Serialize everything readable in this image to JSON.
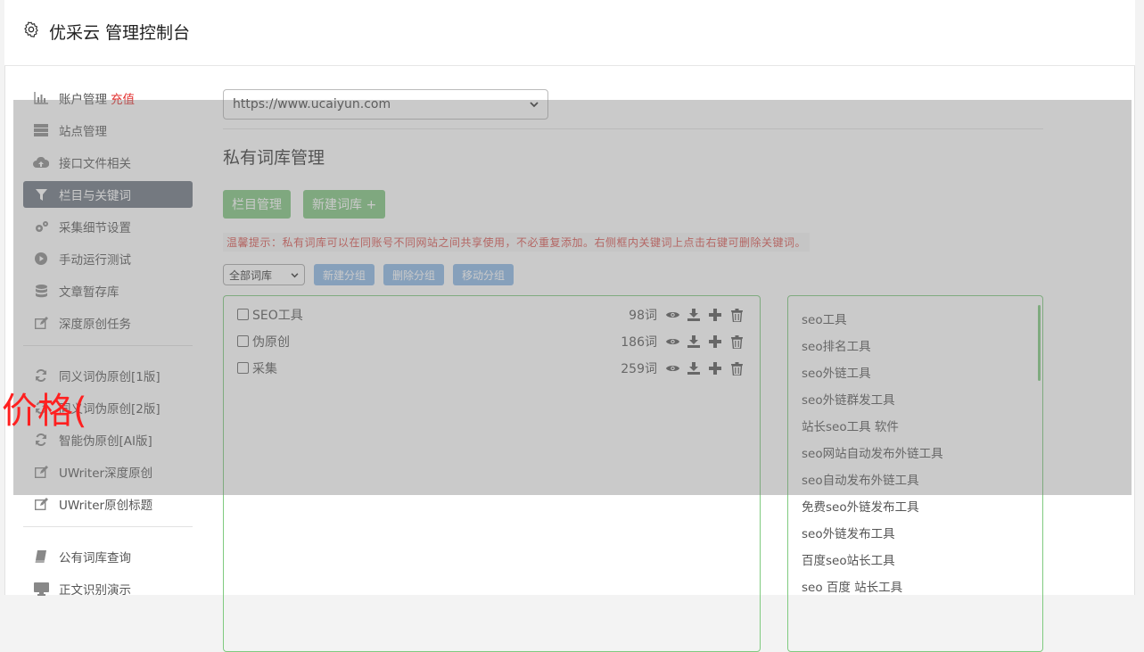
{
  "header": {
    "title": "优采云 管理控制台",
    "icon": "gear-icon"
  },
  "sidebar": {
    "groups": [
      [
        {
          "label": "账户管理",
          "extra": "充值",
          "icon": "bar-chart-icon"
        },
        {
          "label": "站点管理",
          "icon": "server-icon"
        },
        {
          "label": "接口文件相关",
          "icon": "cloud-upload-icon"
        },
        {
          "label": "栏目与关键词",
          "icon": "filter-icon",
          "active": true
        },
        {
          "label": "采集细节设置",
          "icon": "cogs-icon"
        },
        {
          "label": "手动运行测试",
          "icon": "play-circle-icon"
        },
        {
          "label": "文章暂存库",
          "icon": "database-icon"
        },
        {
          "label": "深度原创任务",
          "icon": "edit-icon"
        }
      ],
      [
        {
          "label": "同义词伪原创[1版]",
          "icon": "refresh-icon"
        },
        {
          "label": "同义词伪原创[2版]",
          "icon": "refresh-icon"
        },
        {
          "label": "智能伪原创[AI版]",
          "icon": "refresh-icon"
        },
        {
          "label": "UWriter深度原创",
          "icon": "edit-icon"
        },
        {
          "label": "UWriter原创标题",
          "icon": "edit-icon"
        }
      ],
      [
        {
          "label": "公有词库查询",
          "icon": "book-icon"
        },
        {
          "label": "正文识别演示",
          "icon": "monitor-icon"
        }
      ]
    ]
  },
  "main": {
    "site_select": "https://www.ucaiyun.com",
    "page_title": "私有词库管理",
    "btn_column": "栏目管理",
    "btn_new_lib": "新建词库 +",
    "tip": "温馨提示：私有词库可以在同账号不同网站之间共享使用，不必重复添加。右侧框内关键词上点击右键可删除关键词。",
    "group_select": "全部词库",
    "btn_new_group": "新建分组",
    "btn_del_group": "删除分组",
    "btn_move_group": "移动分组",
    "libraries": [
      {
        "name": "SEO工具",
        "count": "98词"
      },
      {
        "name": "伪原创",
        "count": "186词"
      },
      {
        "name": "采集",
        "count": "259词"
      }
    ],
    "keywords": [
      "seo工具",
      "seo排名工具",
      "seo外链工具",
      "seo外链群发工具",
      "站长seo工具 软件",
      "seo网站自动发布外链工具",
      "seo自动发布外链工具",
      "免费seo外链发布工具",
      "seo外链发布工具",
      "百度seo站长工具",
      "seo 百度 站长工具"
    ]
  },
  "overlay_text": "价格("
}
